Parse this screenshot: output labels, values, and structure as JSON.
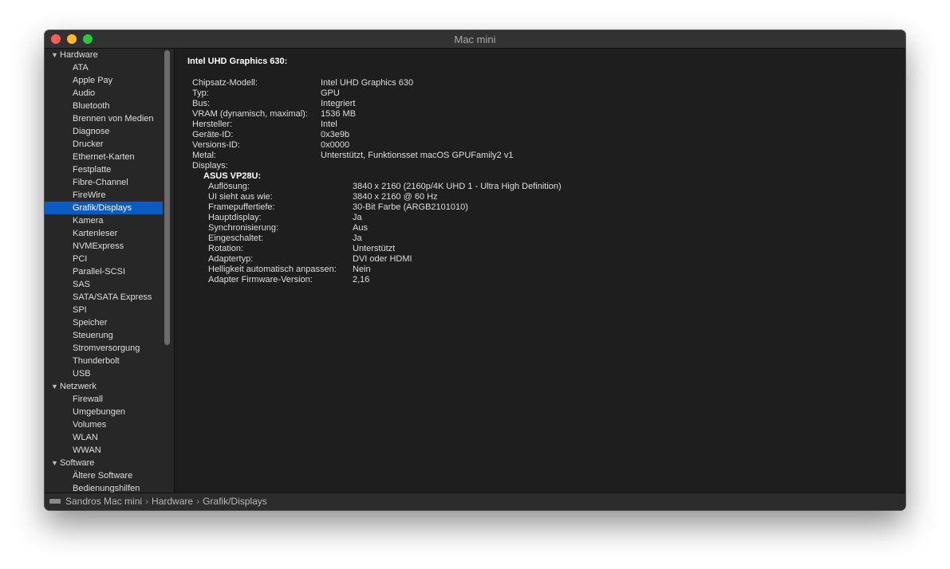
{
  "window": {
    "title": "Mac mini"
  },
  "sidebar": {
    "groups": [
      {
        "label": "Hardware",
        "items": [
          "ATA",
          "Apple Pay",
          "Audio",
          "Bluetooth",
          "Brennen von Medien",
          "Diagnose",
          "Drucker",
          "Ethernet-Karten",
          "Festplatte",
          "Fibre-Channel",
          "FireWire",
          "Grafik/Displays",
          "Kamera",
          "Kartenleser",
          "NVMExpress",
          "PCI",
          "Parallel-SCSI",
          "SAS",
          "SATA/SATA Express",
          "SPI",
          "Speicher",
          "Steuerung",
          "Stromversorgung",
          "Thunderbolt",
          "USB"
        ]
      },
      {
        "label": "Netzwerk",
        "items": [
          "Firewall",
          "Umgebungen",
          "Volumes",
          "WLAN",
          "WWAN"
        ]
      },
      {
        "label": "Software",
        "items": [
          "Ältere Software",
          "Bedienungshilfen"
        ]
      }
    ],
    "selected": "Grafik/Displays",
    "triangle": "▼"
  },
  "content": {
    "heading": "Intel UHD Graphics 630:",
    "properties": [
      {
        "k": "Chipsatz-Modell:",
        "v": "Intel UHD Graphics 630"
      },
      {
        "k": "Typ:",
        "v": "GPU"
      },
      {
        "k": "Bus:",
        "v": "Integriert"
      },
      {
        "k": "VRAM (dynamisch, maximal):",
        "v": "1536 MB"
      },
      {
        "k": "Hersteller:",
        "v": "Intel"
      },
      {
        "k": "Geräte-ID:",
        "v": "0x3e9b"
      },
      {
        "k": "Versions-ID:",
        "v": "0x0000"
      },
      {
        "k": "Metal:",
        "v": "Unterstützt, Funktionsset macOS GPUFamily2 v1"
      },
      {
        "k": "Displays:",
        "v": ""
      }
    ],
    "display_name": "ASUS VP28U:",
    "display_properties": [
      {
        "k": "Auflösung:",
        "v": "3840 x 2160 (2160p/4K UHD 1 - Ultra High Definition)"
      },
      {
        "k": "UI sieht aus wie:",
        "v": "3840 x 2160 @ 60 Hz"
      },
      {
        "k": "Framepuffertiefe:",
        "v": "30-Bit Farbe (ARGB2101010)"
      },
      {
        "k": "Hauptdisplay:",
        "v": "Ja"
      },
      {
        "k": "Synchronisierung:",
        "v": "Aus"
      },
      {
        "k": "Eingeschaltet:",
        "v": "Ja"
      },
      {
        "k": "Rotation:",
        "v": "Unterstützt"
      },
      {
        "k": "Adaptertyp:",
        "v": "DVI oder HDMI"
      },
      {
        "k": "Helligkeit automatisch anpassen:",
        "v": "Nein"
      },
      {
        "k": "Adapter Firmware-Version:",
        "v": "2,16"
      }
    ]
  },
  "statusbar": {
    "crumbs": [
      "Sandros Mac mini",
      "Hardware",
      "Grafik/Displays"
    ],
    "separator": "›"
  },
  "colors": {
    "selection": "#0a5bc4",
    "background": "#1e1e1e"
  }
}
